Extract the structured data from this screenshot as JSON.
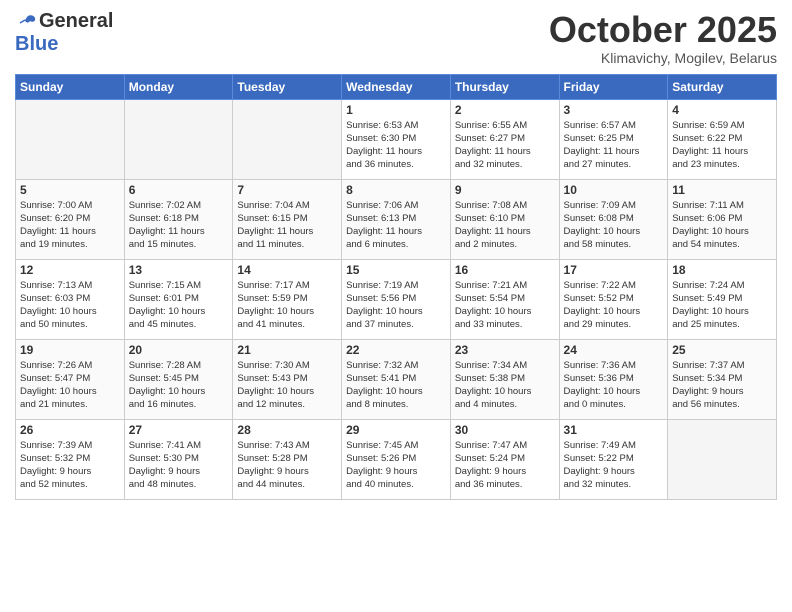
{
  "header": {
    "logo_general": "General",
    "logo_blue": "Blue",
    "month": "October 2025",
    "location": "Klimavichy, Mogilev, Belarus"
  },
  "weekdays": [
    "Sunday",
    "Monday",
    "Tuesday",
    "Wednesday",
    "Thursday",
    "Friday",
    "Saturday"
  ],
  "weeks": [
    [
      {
        "day": "",
        "text": "",
        "empty": true
      },
      {
        "day": "",
        "text": "",
        "empty": true
      },
      {
        "day": "",
        "text": "",
        "empty": true
      },
      {
        "day": "1",
        "text": "Sunrise: 6:53 AM\nSunset: 6:30 PM\nDaylight: 11 hours\nand 36 minutes.",
        "empty": false
      },
      {
        "day": "2",
        "text": "Sunrise: 6:55 AM\nSunset: 6:27 PM\nDaylight: 11 hours\nand 32 minutes.",
        "empty": false
      },
      {
        "day": "3",
        "text": "Sunrise: 6:57 AM\nSunset: 6:25 PM\nDaylight: 11 hours\nand 27 minutes.",
        "empty": false
      },
      {
        "day": "4",
        "text": "Sunrise: 6:59 AM\nSunset: 6:22 PM\nDaylight: 11 hours\nand 23 minutes.",
        "empty": false
      }
    ],
    [
      {
        "day": "5",
        "text": "Sunrise: 7:00 AM\nSunset: 6:20 PM\nDaylight: 11 hours\nand 19 minutes.",
        "empty": false
      },
      {
        "day": "6",
        "text": "Sunrise: 7:02 AM\nSunset: 6:18 PM\nDaylight: 11 hours\nand 15 minutes.",
        "empty": false
      },
      {
        "day": "7",
        "text": "Sunrise: 7:04 AM\nSunset: 6:15 PM\nDaylight: 11 hours\nand 11 minutes.",
        "empty": false
      },
      {
        "day": "8",
        "text": "Sunrise: 7:06 AM\nSunset: 6:13 PM\nDaylight: 11 hours\nand 6 minutes.",
        "empty": false
      },
      {
        "day": "9",
        "text": "Sunrise: 7:08 AM\nSunset: 6:10 PM\nDaylight: 11 hours\nand 2 minutes.",
        "empty": false
      },
      {
        "day": "10",
        "text": "Sunrise: 7:09 AM\nSunset: 6:08 PM\nDaylight: 10 hours\nand 58 minutes.",
        "empty": false
      },
      {
        "day": "11",
        "text": "Sunrise: 7:11 AM\nSunset: 6:06 PM\nDaylight: 10 hours\nand 54 minutes.",
        "empty": false
      }
    ],
    [
      {
        "day": "12",
        "text": "Sunrise: 7:13 AM\nSunset: 6:03 PM\nDaylight: 10 hours\nand 50 minutes.",
        "empty": false
      },
      {
        "day": "13",
        "text": "Sunrise: 7:15 AM\nSunset: 6:01 PM\nDaylight: 10 hours\nand 45 minutes.",
        "empty": false
      },
      {
        "day": "14",
        "text": "Sunrise: 7:17 AM\nSunset: 5:59 PM\nDaylight: 10 hours\nand 41 minutes.",
        "empty": false
      },
      {
        "day": "15",
        "text": "Sunrise: 7:19 AM\nSunset: 5:56 PM\nDaylight: 10 hours\nand 37 minutes.",
        "empty": false
      },
      {
        "day": "16",
        "text": "Sunrise: 7:21 AM\nSunset: 5:54 PM\nDaylight: 10 hours\nand 33 minutes.",
        "empty": false
      },
      {
        "day": "17",
        "text": "Sunrise: 7:22 AM\nSunset: 5:52 PM\nDaylight: 10 hours\nand 29 minutes.",
        "empty": false
      },
      {
        "day": "18",
        "text": "Sunrise: 7:24 AM\nSunset: 5:49 PM\nDaylight: 10 hours\nand 25 minutes.",
        "empty": false
      }
    ],
    [
      {
        "day": "19",
        "text": "Sunrise: 7:26 AM\nSunset: 5:47 PM\nDaylight: 10 hours\nand 21 minutes.",
        "empty": false
      },
      {
        "day": "20",
        "text": "Sunrise: 7:28 AM\nSunset: 5:45 PM\nDaylight: 10 hours\nand 16 minutes.",
        "empty": false
      },
      {
        "day": "21",
        "text": "Sunrise: 7:30 AM\nSunset: 5:43 PM\nDaylight: 10 hours\nand 12 minutes.",
        "empty": false
      },
      {
        "day": "22",
        "text": "Sunrise: 7:32 AM\nSunset: 5:41 PM\nDaylight: 10 hours\nand 8 minutes.",
        "empty": false
      },
      {
        "day": "23",
        "text": "Sunrise: 7:34 AM\nSunset: 5:38 PM\nDaylight: 10 hours\nand 4 minutes.",
        "empty": false
      },
      {
        "day": "24",
        "text": "Sunrise: 7:36 AM\nSunset: 5:36 PM\nDaylight: 10 hours\nand 0 minutes.",
        "empty": false
      },
      {
        "day": "25",
        "text": "Sunrise: 7:37 AM\nSunset: 5:34 PM\nDaylight: 9 hours\nand 56 minutes.",
        "empty": false
      }
    ],
    [
      {
        "day": "26",
        "text": "Sunrise: 7:39 AM\nSunset: 5:32 PM\nDaylight: 9 hours\nand 52 minutes.",
        "empty": false
      },
      {
        "day": "27",
        "text": "Sunrise: 7:41 AM\nSunset: 5:30 PM\nDaylight: 9 hours\nand 48 minutes.",
        "empty": false
      },
      {
        "day": "28",
        "text": "Sunrise: 7:43 AM\nSunset: 5:28 PM\nDaylight: 9 hours\nand 44 minutes.",
        "empty": false
      },
      {
        "day": "29",
        "text": "Sunrise: 7:45 AM\nSunset: 5:26 PM\nDaylight: 9 hours\nand 40 minutes.",
        "empty": false
      },
      {
        "day": "30",
        "text": "Sunrise: 7:47 AM\nSunset: 5:24 PM\nDaylight: 9 hours\nand 36 minutes.",
        "empty": false
      },
      {
        "day": "31",
        "text": "Sunrise: 7:49 AM\nSunset: 5:22 PM\nDaylight: 9 hours\nand 32 minutes.",
        "empty": false
      },
      {
        "day": "",
        "text": "",
        "empty": true
      }
    ]
  ]
}
